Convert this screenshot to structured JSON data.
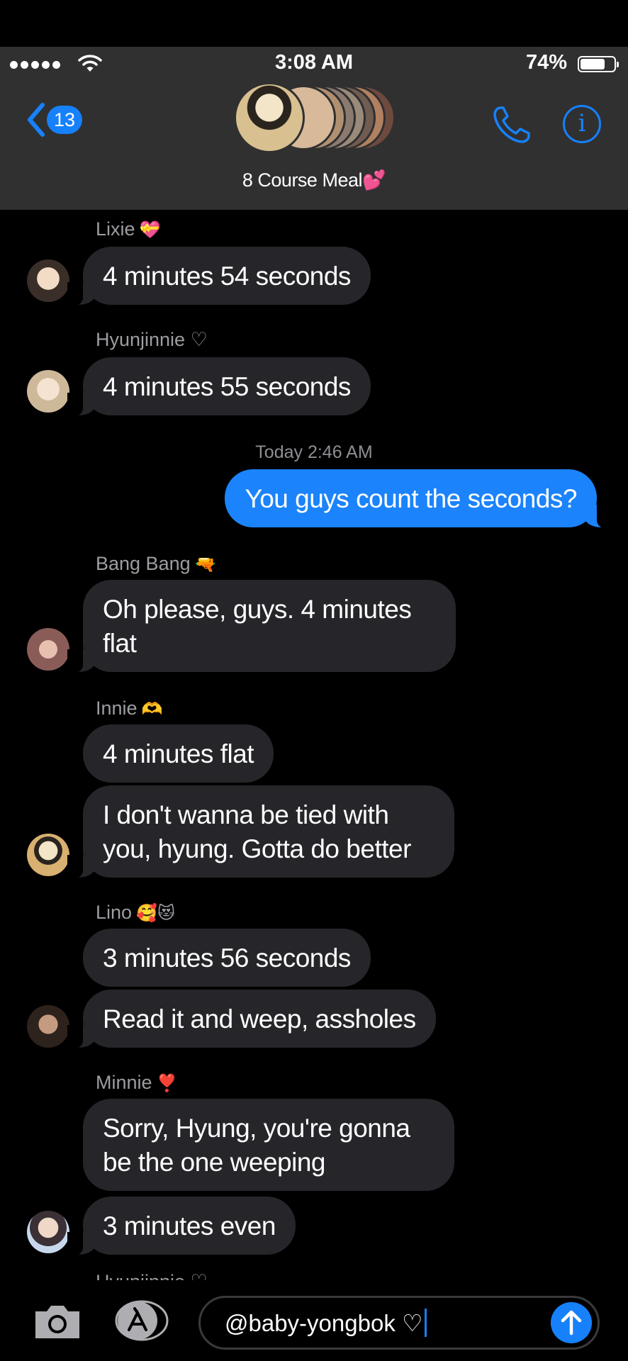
{
  "status_bar": {
    "time": "3:08 AM",
    "battery": "74%"
  },
  "header": {
    "back_count": "13",
    "group_name": "8 Course Meal💕",
    "avatar_colors": [
      "#c9a46b",
      "#d8b99a",
      "#b09070",
      "#8a7a70",
      "#9a8a7a",
      "#705c50",
      "#b08060",
      "#6e4a3e"
    ]
  },
  "messages": {
    "m1": {
      "sender": "Lixie",
      "sender_emoji": "💝",
      "text": "4 minutes 54 seconds"
    },
    "m2": {
      "sender": "Hyunjinnie ♡",
      "text": "4 minutes 55 seconds"
    },
    "timestamp": "Today 2:46 AM",
    "m3": {
      "text": "You guys count the seconds?"
    },
    "m4": {
      "sender": "Bang Bang",
      "sender_emoji": "🔫",
      "text": "Oh please, guys. 4 minutes flat"
    },
    "m5": {
      "sender": "Innie",
      "sender_emoji": "🫶",
      "text": "4 minutes flat"
    },
    "m6": {
      "text": "I don't wanna be tied with you, hyung. Gotta do better"
    },
    "m7": {
      "sender": "Lino",
      "sender_emoji": "🥰😻",
      "text": "3 minutes 56 seconds"
    },
    "m8": {
      "text": "Read it and weep, assholes"
    },
    "m9": {
      "sender": "Minnie",
      "sender_emoji": "❣️",
      "text": "Sorry, Hyung, you're gonna be the one weeping"
    },
    "m10": {
      "text": "3 minutes even"
    },
    "next_sender": "Hyunjinnie ♡"
  },
  "compose": {
    "value": "@baby-yongbok ♡"
  },
  "colors": {
    "accent": "#1681fb",
    "incoming_bubble": "#26262a",
    "outgoing_bubble": "#1b83fb",
    "header_bg": "#303031"
  }
}
